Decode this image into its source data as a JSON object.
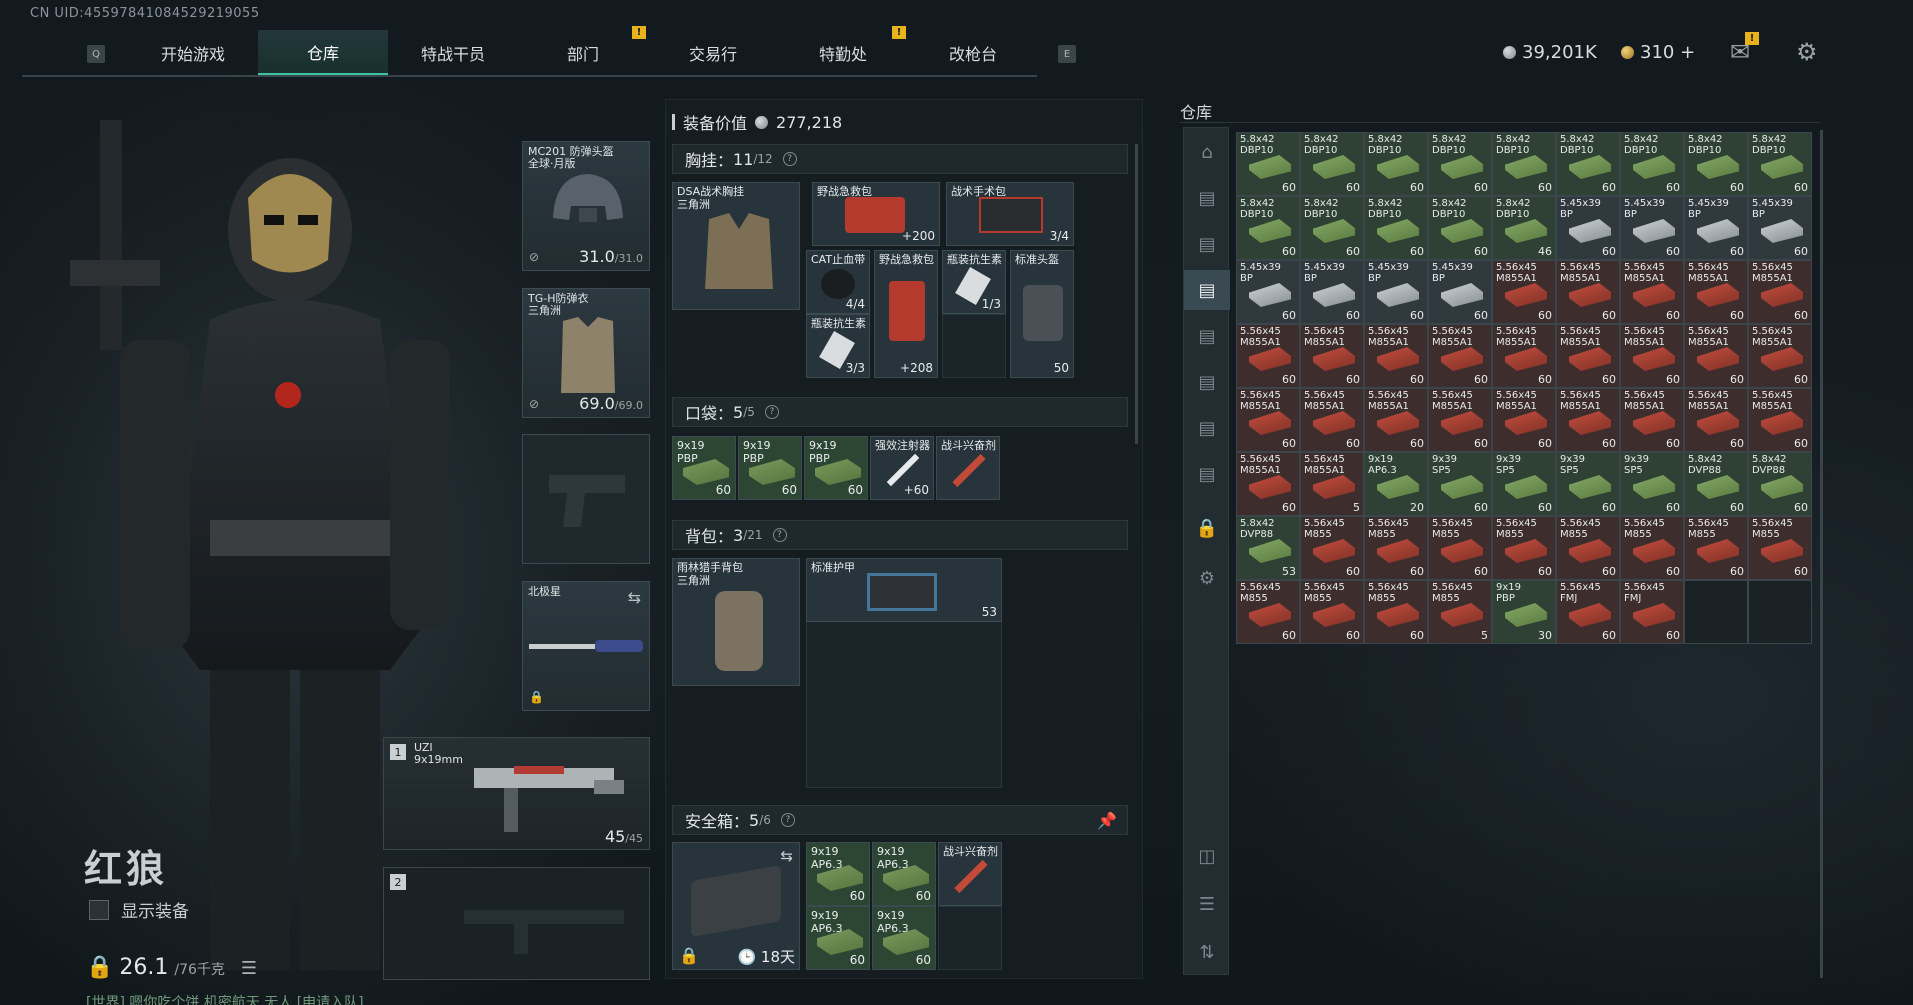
{
  "uid": "CN UID:4559784108452921​9055",
  "nav": {
    "key_left": "Q",
    "key_right": "E",
    "tabs": [
      "开始游戏",
      "仓库",
      "特战干员",
      "部门",
      "交易行",
      "特勤处",
      "改枪台"
    ],
    "notif": "!"
  },
  "currency": {
    "silver": "39,201K",
    "gold": "310 +"
  },
  "operator": {
    "name": "红狼",
    "show_equipment": "显示装备",
    "weight": "26.1",
    "weight_max": "/76千克",
    "chat": "[世界] 嗯你吃个饼 机密航天 无人 [申请入队]"
  },
  "slots": {
    "helmet": {
      "label": "MC201 防弹头盔\n全球·月版",
      "dur": "31.0",
      "dur_max": "/31.0"
    },
    "armor": {
      "label": "TG-H防弹衣\n三角洲",
      "dur": "69.0",
      "dur_max": "/69.0"
    },
    "melee": {
      "label": "北极星"
    },
    "primary": {
      "num": "1",
      "label": "UZI\n9x19mm",
      "ammo": "45",
      "ammo_max": "/45"
    },
    "secondary": {
      "num": "2"
    }
  },
  "mid": {
    "value_label": "装备价值",
    "value": "277,218",
    "chest": {
      "title": "胸挂：",
      "count": "11",
      "max": "/12"
    },
    "pocket": {
      "title": "口袋：",
      "count": "5",
      "max": "/5"
    },
    "backpack": {
      "title": "背包：",
      "count": "3",
      "max": "/21"
    },
    "safe": {
      "title": "安全箱：",
      "count": "5",
      "max": "/6",
      "days": "18天"
    },
    "chest_items": [
      {
        "n": "DSA战术胸挂\n三角洲",
        "c": ""
      },
      {
        "n": "野战急救包",
        "c": "+200"
      },
      {
        "n": "战术手术包",
        "c": "3/4"
      },
      {
        "n": "CAT止血带",
        "c": "4/4"
      },
      {
        "n": "野战急救包",
        "c": "+208"
      },
      {
        "n": "瓶装抗生素",
        "c": "1/3"
      },
      {
        "n": "标准头盔",
        "c": "50"
      },
      {
        "n": "瓶装抗生素",
        "c": "3/3"
      }
    ],
    "pocket_items": [
      {
        "n": "9x19\nPBP",
        "c": "60"
      },
      {
        "n": "9x19\nPBP",
        "c": "60"
      },
      {
        "n": "9x19\nPBP",
        "c": "60"
      },
      {
        "n": "强效注射器",
        "c": "+60"
      },
      {
        "n": "战斗兴奋剂",
        "c": ""
      }
    ],
    "backpack_items": [
      {
        "n": "雨林猎手背包\n三角洲",
        "c": ""
      },
      {
        "n": "标准护甲",
        "c": "53"
      }
    ],
    "safe_items": [
      {
        "n": "9x19\nAP6.3",
        "c": "60"
      },
      {
        "n": "9x19\nAP6.3",
        "c": "60"
      },
      {
        "n": "战斗兴奋剂",
        "c": ""
      },
      {
        "n": "9x19\nAP6.3",
        "c": "60"
      },
      {
        "n": "9x19\nAP6.3",
        "c": "60"
      }
    ]
  },
  "storage": {
    "title": "仓库",
    "cells": [
      [
        "5.8x42\nDBP10",
        "60",
        "g"
      ],
      [
        "5.8x42\nDBP10",
        "60",
        "g"
      ],
      [
        "5.8x42\nDBP10",
        "60",
        "g"
      ],
      [
        "5.8x42\nDBP10",
        "60",
        "g"
      ],
      [
        "5.8x42\nDBP10",
        "60",
        "g"
      ],
      [
        "5.8x42\nDBP10",
        "60",
        "g"
      ],
      [
        "5.8x42\nDBP10",
        "60",
        "g"
      ],
      [
        "5.8x42\nDBP10",
        "60",
        "g"
      ],
      [
        "5.8x42\nDBP10",
        "60",
        "g"
      ],
      [
        "5.8x42\nDBP10",
        "60",
        "g"
      ],
      [
        "5.8x42\nDBP10",
        "60",
        "g"
      ],
      [
        "5.8x42\nDBP10",
        "60",
        "g"
      ],
      [
        "5.8x42\nDBP10",
        "60",
        "g"
      ],
      [
        "5.8x42\nDBP10",
        "46",
        "g"
      ],
      [
        "5.45x39\nBP",
        "60",
        "s"
      ],
      [
        "5.45x39\nBP",
        "60",
        "s"
      ],
      [
        "5.45x39\nBP",
        "60",
        "s"
      ],
      [
        "5.45x39\nBP",
        "60",
        "s"
      ],
      [
        "5.45x39\nBP",
        "60",
        "s"
      ],
      [
        "5.45x39\nBP",
        "60",
        "s"
      ],
      [
        "5.45x39\nBP",
        "60",
        "s"
      ],
      [
        "5.45x39\nBP",
        "60",
        "s"
      ],
      [
        "5.56x45\nM855A1",
        "60",
        "r"
      ],
      [
        "5.56x45\nM855A1",
        "60",
        "r"
      ],
      [
        "5.56x45\nM855A1",
        "60",
        "r"
      ],
      [
        "5.56x45\nM855A1",
        "60",
        "r"
      ],
      [
        "5.56x45\nM855A1",
        "60",
        "r"
      ],
      [
        "5.56x45\nM855A1",
        "60",
        "r"
      ],
      [
        "5.56x45\nM855A1",
        "60",
        "r"
      ],
      [
        "5.56x45\nM855A1",
        "60",
        "r"
      ],
      [
        "5.56x45\nM855A1",
        "60",
        "r"
      ],
      [
        "5.56x45\nM855A1",
        "60",
        "r"
      ],
      [
        "5.56x45\nM855A1",
        "60",
        "r"
      ],
      [
        "5.56x45\nM855A1",
        "60",
        "r"
      ],
      [
        "5.56x45\nM855A1",
        "60",
        "r"
      ],
      [
        "5.56x45\nM855A1",
        "60",
        "r"
      ],
      [
        "5.56x45\nM855A1",
        "60",
        "r"
      ],
      [
        "5.56x45\nM855A1",
        "60",
        "r"
      ],
      [
        "5.56x45\nM855A1",
        "60",
        "r"
      ],
      [
        "5.56x45\nM855A1",
        "60",
        "r"
      ],
      [
        "5.56x45\nM855A1",
        "60",
        "r"
      ],
      [
        "5.56x45\nM855A1",
        "60",
        "r"
      ],
      [
        "5.56x45\nM855A1",
        "60",
        "r"
      ],
      [
        "5.56x45\nM855A1",
        "60",
        "r"
      ],
      [
        "5.56x45\nM855A1",
        "60",
        "r"
      ],
      [
        "5.56x45\nM855A1",
        "60",
        "r"
      ],
      [
        "5.56x45\nM855A1",
        "5",
        "r"
      ],
      [
        "9x19\nAP6.3",
        "20",
        "g"
      ],
      [
        "9x39\nSP5",
        "60",
        "g"
      ],
      [
        "9x39\nSP5",
        "60",
        "g"
      ],
      [
        "9x39\nSP5",
        "60",
        "g"
      ],
      [
        "9x39\nSP5",
        "60",
        "g"
      ],
      [
        "5.8x42\nDVP88",
        "60",
        "g"
      ],
      [
        "5.8x42\nDVP88",
        "60",
        "g"
      ],
      [
        "5.8x42\nDVP88",
        "53",
        "g"
      ],
      [
        "5.56x45\nM855",
        "60",
        "r"
      ],
      [
        "5.56x45\nM855",
        "60",
        "r"
      ],
      [
        "5.56x45\nM855",
        "60",
        "r"
      ],
      [
        "5.56x45\nM855",
        "60",
        "r"
      ],
      [
        "5.56x45\nM855",
        "60",
        "r"
      ],
      [
        "5.56x45\nM855",
        "60",
        "r"
      ],
      [
        "5.56x45\nM855",
        "60",
        "r"
      ],
      [
        "5.56x45\nM855",
        "60",
        "r"
      ],
      [
        "5.56x45\nM855",
        "60",
        "r"
      ],
      [
        "5.56x45\nM855",
        "60",
        "r"
      ],
      [
        "5.56x45\nM855",
        "60",
        "r"
      ],
      [
        "5.56x45\nM855",
        "5",
        "r"
      ],
      [
        "9x19\nPBP",
        "30",
        "g"
      ],
      [
        "5.56x45\nFMJ",
        "60",
        "r"
      ],
      [
        "5.56x45\nFMJ",
        "60",
        "r"
      ],
      [
        "",
        "",
        "e"
      ],
      [
        "",
        "",
        "e"
      ]
    ]
  }
}
